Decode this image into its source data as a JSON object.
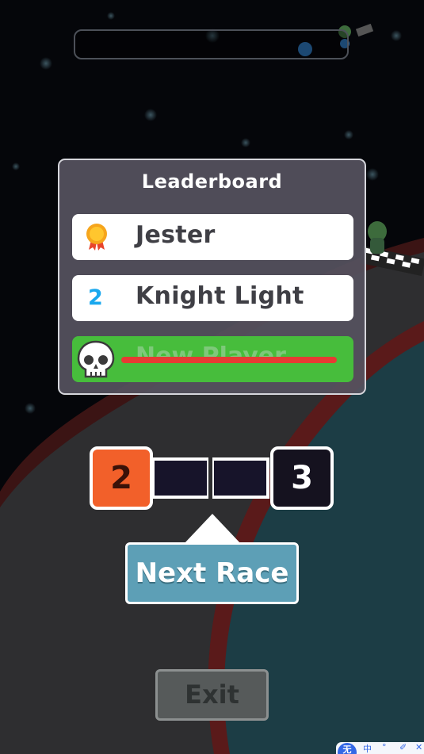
{
  "leaderboard": {
    "title": "Leaderboard",
    "entries": [
      {
        "rank_icon": "medal-icon",
        "name": "Jester"
      },
      {
        "rank": "2",
        "name": "Knight Light"
      },
      {
        "rank_icon": "skull-icon",
        "name": "New Player",
        "eliminated": true
      }
    ]
  },
  "progress": {
    "current_level": "2",
    "next_level": "3",
    "segments_total": 2,
    "segments_filled": 0
  },
  "buttons": {
    "next_race": "Next Race",
    "exit": "Exit"
  },
  "ime": {
    "logo": "无",
    "items": [
      "中",
      "°",
      "✐",
      "✕"
    ]
  },
  "colors": {
    "current_level_bg": "#f2602a",
    "eliminated_row": "#47bd3c",
    "strike": "#e63b33",
    "next_race_bg": "#5d9fb6",
    "rank2": "#1aa8ee"
  }
}
